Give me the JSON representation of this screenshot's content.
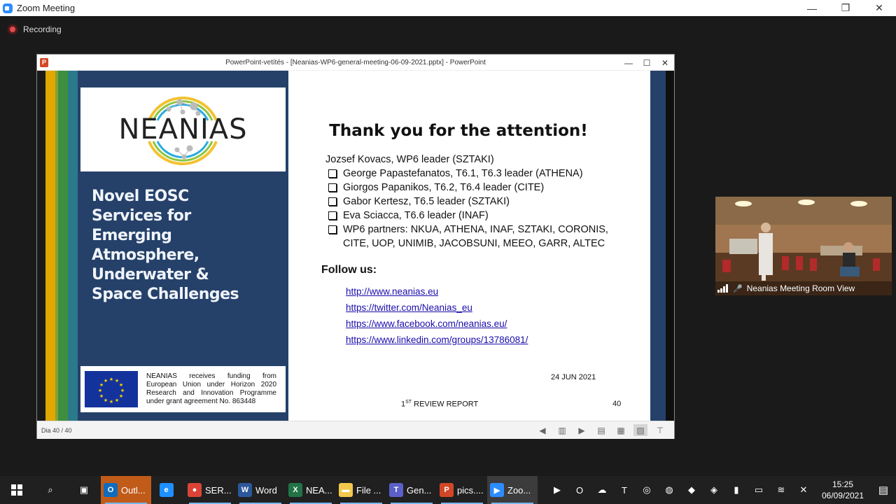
{
  "zoom": {
    "window_title": "Zoom Meeting",
    "recording_label": "Recording",
    "controls": {
      "minimize": "—",
      "restore": "❐",
      "close": "✕"
    }
  },
  "powerpoint": {
    "window_title": "PowerPoint-vetítés - [Neanias-WP6-general-meeting-06-09-2021.pptx] - PowerPoint",
    "controls": {
      "minimize": "—",
      "maximize": "☐",
      "close": "✕"
    },
    "status": {
      "slide_counter": "Dia 40 / 40"
    }
  },
  "slide": {
    "logo": "NEANIAS",
    "tagline": "Novel EOSC Services for Emerging Atmosphere, Underwater & Space Challenges",
    "eu_funding": "NEANIAS receives funding from European Union under Horizon 2020 Research and Innovation Programme under grant agreement No. 863448",
    "title": "Thank you for the attention!",
    "lead": "Jozsef Kovacs, WP6 leader (SZTAKI)",
    "bullets": [
      "George Papastefanatos, T6.1, T6.3 leader (ATHENA)",
      "Giorgos Papanikos, T6.2, T6.4 leader (CITE)",
      "Gabor Kertesz, T6.5 leader (SZTAKI)",
      "Eva Sciacca, T6.6 leader (INAF)",
      "WP6 partners: NKUA, ATHENA, INAF, SZTAKI, CORONIS,"
    ],
    "bullet_continuation": "CITE, UOP, UNIMIB, JACOBSUNI, MEEO, GARR, ALTEC",
    "follow_label": "Follow us:",
    "links": [
      "http://www.neanias.eu",
      "https://twitter.com/Neanias_eu",
      "https://www.facebook.com/neanias.eu/",
      "https://www.linkedin.com/groups/13786081/"
    ],
    "date": "24 JUN 2021",
    "report_prefix": "1",
    "report_sup": "ST",
    "report_suffix": " REVIEW REPORT",
    "page_number": "40",
    "stripe_colors": [
      "#1a1a1a",
      "#e0a800",
      "#8aa033",
      "#3e8f3e",
      "#2a7a8a"
    ]
  },
  "video": {
    "participant_name": "Neanias Meeting Room View"
  },
  "taskbar": {
    "apps": [
      {
        "label": "Outl...",
        "icon": "outlook-icon",
        "glyph": "O",
        "color": "#0f6cbd",
        "state": "highlight"
      },
      {
        "label": "",
        "icon": "internet-explorer-icon",
        "glyph": "e",
        "color": "#1e90ff",
        "state": "none"
      },
      {
        "label": "SER...",
        "icon": "chrome-icon",
        "glyph": "●",
        "color": "#db4437",
        "state": "open"
      },
      {
        "label": "Word",
        "icon": "word-icon",
        "glyph": "W",
        "color": "#2b579a",
        "state": "open"
      },
      {
        "label": "NEA...",
        "icon": "excel-icon",
        "glyph": "X",
        "color": "#217346",
        "state": "open"
      },
      {
        "label": "File ...",
        "icon": "file-explorer-icon",
        "glyph": "▬",
        "color": "#f2c94c",
        "state": "open"
      },
      {
        "label": "Gen...",
        "icon": "teams-icon",
        "glyph": "T",
        "color": "#5b5fc7",
        "state": "open"
      },
      {
        "label": "pics....",
        "icon": "powerpoint-icon",
        "glyph": "P",
        "color": "#d24726",
        "state": "open"
      },
      {
        "label": "Zoo...",
        "icon": "zoom-icon",
        "glyph": "▶",
        "color": "#2d8cff",
        "state": "active"
      }
    ],
    "clock_time": "15:25",
    "clock_date": "06/09/2021"
  }
}
